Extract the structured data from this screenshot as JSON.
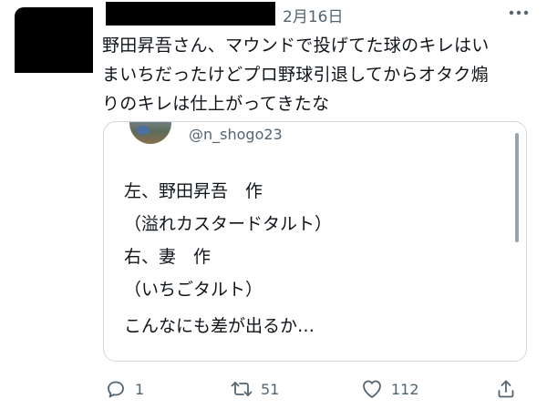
{
  "header": {
    "timestamp": "2月16日"
  },
  "tweet": {
    "text_lines": [
      "野田昇吾さん、マウンドで投げてた球のキレはい",
      "まいちだったけどプロ野球引退してからオタク煽",
      "りのキレは仕上がってきたな"
    ]
  },
  "quote": {
    "handle": "@n_shogo23",
    "lines": [
      "左、野田昇吾　作",
      "（溢れカスタードタルト）",
      "右、妻　作",
      "（いちごタルト）",
      "こんなにも差が出るか…"
    ]
  },
  "actions": {
    "reply_count": "1",
    "retweet_count": "51",
    "like_count": "112"
  },
  "icons": {
    "more": "more-horizontal-icon",
    "reply": "reply-icon",
    "retweet": "retweet-icon",
    "like": "heart-icon",
    "share": "share-icon"
  },
  "colors": {
    "text": "#0f1419",
    "secondary": "#536471",
    "border": "#cfd9de"
  }
}
